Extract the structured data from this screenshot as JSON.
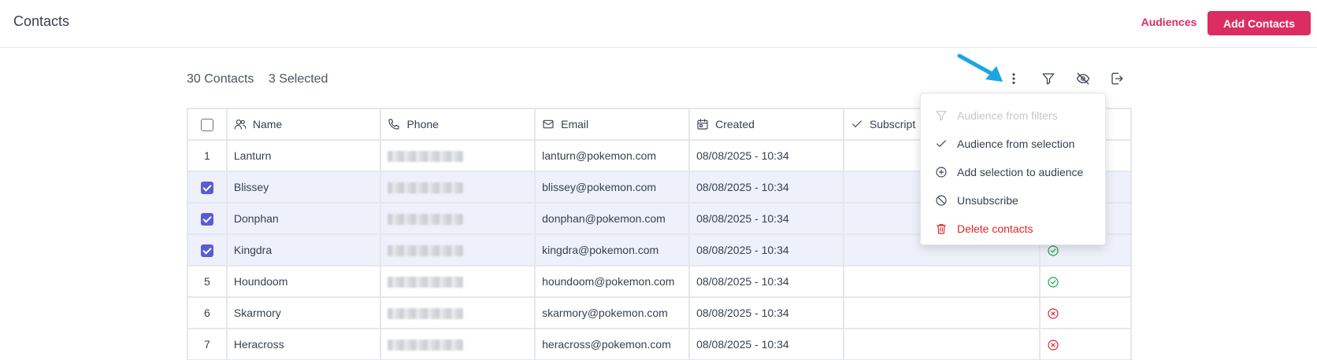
{
  "header": {
    "title": "Contacts",
    "audiences_label": "Audiences",
    "add_contacts_label": "Add Contacts"
  },
  "summary": {
    "contacts_count": "30 Contacts",
    "selected_count": "3 Selected"
  },
  "toolbar": {
    "icons": [
      "more-vertical-icon",
      "filter-icon",
      "eye-off-icon",
      "export-icon"
    ]
  },
  "table": {
    "columns": [
      "Name",
      "Phone",
      "Email",
      "Created",
      "Subscript"
    ],
    "rows": [
      {
        "index": "1",
        "name": "Lanturn",
        "email": "lanturn@pokemon.com",
        "created": "08/08/2025 - 10:34",
        "selected": false,
        "status": "none"
      },
      {
        "index": "",
        "name": "Blissey",
        "email": "blissey@pokemon.com",
        "created": "08/08/2025 - 10:34",
        "selected": true,
        "status": "none"
      },
      {
        "index": "",
        "name": "Donphan",
        "email": "donphan@pokemon.com",
        "created": "08/08/2025 - 10:34",
        "selected": true,
        "status": "none"
      },
      {
        "index": "",
        "name": "Kingdra",
        "email": "kingdra@pokemon.com",
        "created": "08/08/2025 - 10:34",
        "selected": true,
        "status": "subscribed"
      },
      {
        "index": "5",
        "name": "Houndoom",
        "email": "houndoom@pokemon.com",
        "created": "08/08/2025 - 10:34",
        "selected": false,
        "status": "subscribed"
      },
      {
        "index": "6",
        "name": "Skarmory",
        "email": "skarmory@pokemon.com",
        "created": "08/08/2025 - 10:34",
        "selected": false,
        "status": "unsubscribed"
      },
      {
        "index": "7",
        "name": "Heracross",
        "email": "heracross@pokemon.com",
        "created": "08/08/2025 - 10:34",
        "selected": false,
        "status": "unsubscribed"
      }
    ]
  },
  "menu": {
    "items": [
      {
        "label": "Audience from filters",
        "icon": "filter-icon",
        "disabled": true
      },
      {
        "label": "Audience from selection",
        "icon": "check-icon"
      },
      {
        "label": "Add selection to audience",
        "icon": "plus-circle-icon"
      },
      {
        "label": "Unsubscribe",
        "icon": "ban-icon"
      },
      {
        "label": "Delete contacts",
        "icon": "trash-icon",
        "danger": true
      }
    ]
  },
  "colors": {
    "accent": "#db2d62",
    "selection": "#5b5bd6",
    "selected_row": "#eef0fb",
    "success": "#16a34a",
    "danger": "#dc2626",
    "annotation_arrow": "#1aa7e0"
  }
}
